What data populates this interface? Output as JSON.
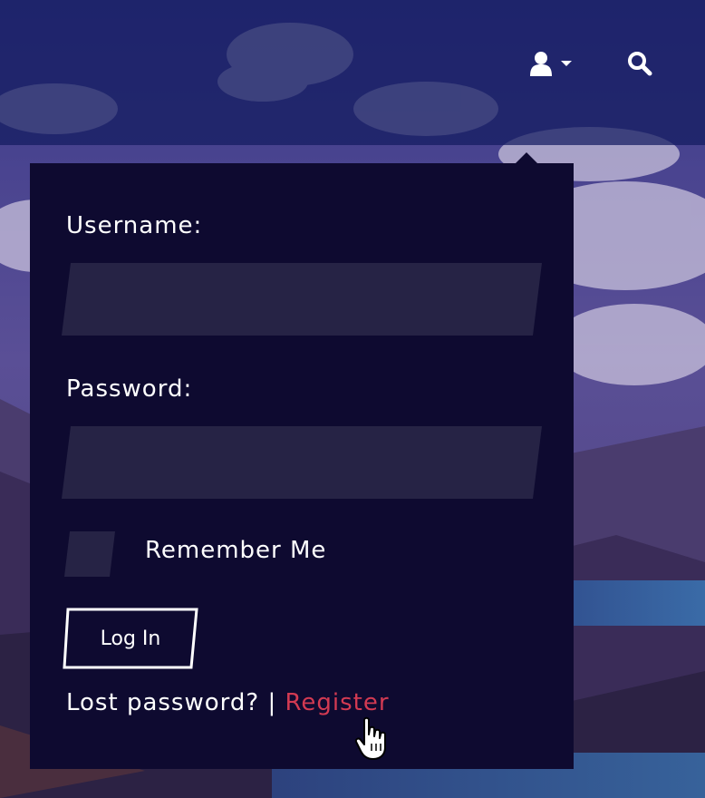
{
  "header": {
    "user_icon": "user-icon",
    "dropdown_icon": "caret-down-icon",
    "search_icon": "search-icon"
  },
  "login": {
    "username_label": "Username:",
    "username_value": "",
    "password_label": "Password:",
    "password_value": "",
    "remember_label": "Remember Me",
    "remember_checked": false,
    "login_button": "Log In",
    "lost_password": "Lost password?",
    "separator": " | ",
    "register": "Register"
  },
  "colors": {
    "panel": "#0e0a30",
    "field": "#262345",
    "register_link": "#d23a52",
    "header_overlay": "#141c60"
  },
  "pointer": "hand-pointer-icon"
}
